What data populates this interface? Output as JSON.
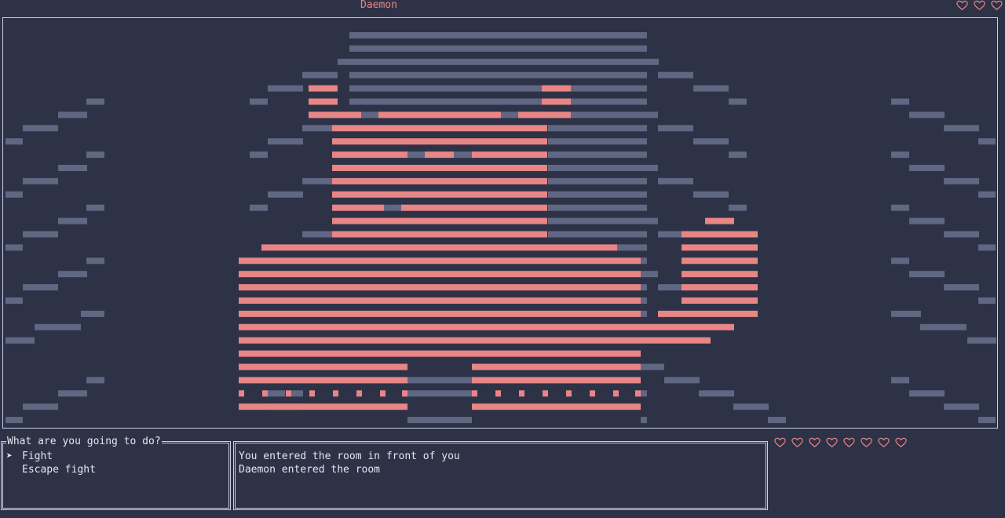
{
  "window": {
    "title": "Daemon"
  },
  "enemy_health": {
    "hearts": 3,
    "color": "#e88585"
  },
  "player_health": {
    "hearts": 8,
    "color": "#e88585"
  },
  "menu": {
    "prompt": "What are you going to do?",
    "cursor": "➤",
    "options": [
      {
        "label": "Fight",
        "selected": true
      },
      {
        "label": "Escape fight",
        "selected": false
      }
    ]
  },
  "log": {
    "lines": [
      "You entered the room in front of you",
      "Daemon entered the room"
    ]
  },
  "palette": {
    "background": "#2e3247",
    "enemy": "#e88585",
    "stone": "#5f6782",
    "frame": "#c8cde6",
    "text": "#e4e6f0"
  }
}
